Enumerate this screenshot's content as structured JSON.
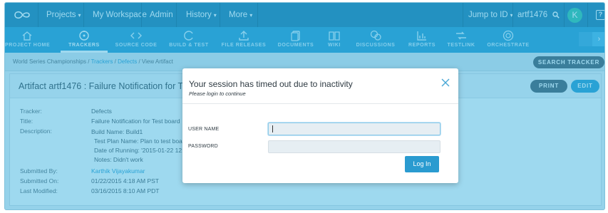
{
  "topnav": {
    "items": [
      {
        "label": "Projects",
        "caret": "▾"
      },
      {
        "label": "My Workspace"
      },
      {
        "label": "Admin"
      },
      {
        "label": "History",
        "caret": "▾"
      },
      {
        "label": "More",
        "caret": "▾"
      }
    ],
    "jump_label": "Jump to ID",
    "jump_caret": "▾",
    "jump_value": "artf1476",
    "search_icon": "search-icon",
    "avatar_letter": "K",
    "help_glyph": "?"
  },
  "tools": [
    {
      "label": "PROJECT HOME",
      "icon": "home-icon"
    },
    {
      "label": "TRACKERS",
      "icon": "tracker-icon",
      "active": true
    },
    {
      "label": "SOURCE CODE",
      "icon": "code-icon"
    },
    {
      "label": "BUILD & TEST",
      "icon": "build-icon"
    },
    {
      "label": "FILE RELEASES",
      "icon": "upload-icon"
    },
    {
      "label": "DOCUMENTS",
      "icon": "documents-icon"
    },
    {
      "label": "WIKI",
      "icon": "wiki-icon"
    },
    {
      "label": "DISCUSSIONS",
      "icon": "discussions-icon"
    },
    {
      "label": "REPORTS",
      "icon": "reports-icon"
    },
    {
      "label": "TESTLINK",
      "icon": "testlink-icon"
    },
    {
      "label": "ORCHESTRATE",
      "icon": "orchestrate-icon"
    }
  ],
  "breadcrumb": {
    "project": "World Series Championships",
    "sep": "/",
    "trackers": "Trackers",
    "defects": "Defects",
    "current": "View Artifact"
  },
  "search_tracker_label": "SEARCH TRACKER",
  "artifact": {
    "title": "Artifact artf1476 : Failure Notification for Test bo",
    "print_label": "PRINT",
    "edit_label": "EDIT",
    "fields": {
      "tracker_label": "Tracker:",
      "tracker_value": "Defects",
      "title_label": "Title:",
      "title_value": "Failure Notification for Test board",
      "description_label": "Description:",
      "description_lines": [
        "Build Name: Build1",
        "Test Plan Name: Plan to test board",
        "Date of Running: '2015-01-22 12:18",
        "Notes: Didn't work"
      ],
      "submitted_by_label": "Submitted By:",
      "submitted_by_value": "Karthik Vijayakumar",
      "submitted_on_label": "Submitted On:",
      "submitted_on_value": "01/22/2015 4:18 AM PST",
      "last_modified_label": "Last Modified:",
      "last_modified_value": "03/16/2015 8:10 AM PDT"
    }
  },
  "modal": {
    "title": "Your session has timed out due to inactivity",
    "subtitle": "Please login to continue",
    "username_label": "USER NAME",
    "username_value": "",
    "password_label": "PASSWORD",
    "password_value": "",
    "login_label": "Log In",
    "close_icon": "close-icon"
  },
  "colors": {
    "topnav": "#1f7cac",
    "toolbar": "#2a9bd0",
    "overlay": "rgba(40,170,220,0.45)",
    "accent": "#2a9bd0",
    "dark_button": "#4a5a66"
  }
}
